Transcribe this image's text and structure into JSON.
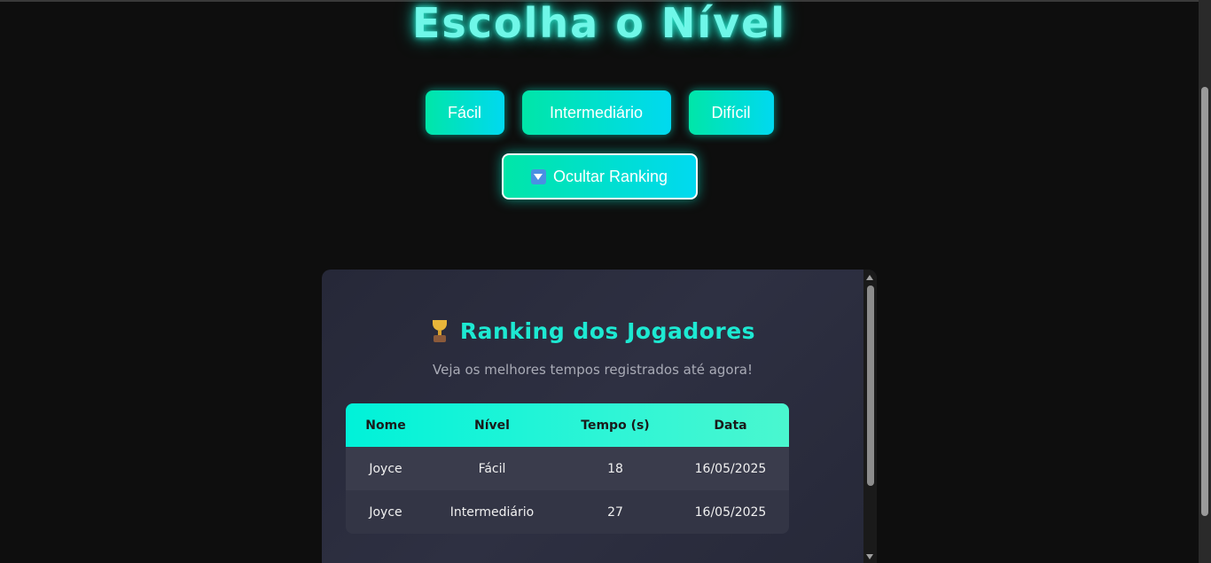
{
  "page": {
    "title": "Escolha o Nível"
  },
  "levels": [
    {
      "label": "Fácil"
    },
    {
      "label": "Intermediário"
    },
    {
      "label": "Difícil"
    }
  ],
  "toggle": {
    "label": "Ocultar Ranking",
    "icon": "down-arrow-button-icon"
  },
  "ranking": {
    "icon": "trophy-icon",
    "title": "Ranking dos Jogadores",
    "subtitle": "Veja os melhores tempos registrados até agora!",
    "columns": [
      "Nome",
      "Nível",
      "Tempo (s)",
      "Data"
    ],
    "rows": [
      [
        "Joyce",
        "Fácil",
        "18",
        "16/05/2025"
      ],
      [
        "Joyce",
        "Intermediário",
        "27",
        "16/05/2025"
      ]
    ]
  },
  "colors": {
    "accent": "#1de9d2",
    "button_gradient_start": "#00e6a8",
    "button_gradient_end": "#00d9f0",
    "background": "#0e0e0e",
    "panel": "#2e3042"
  }
}
